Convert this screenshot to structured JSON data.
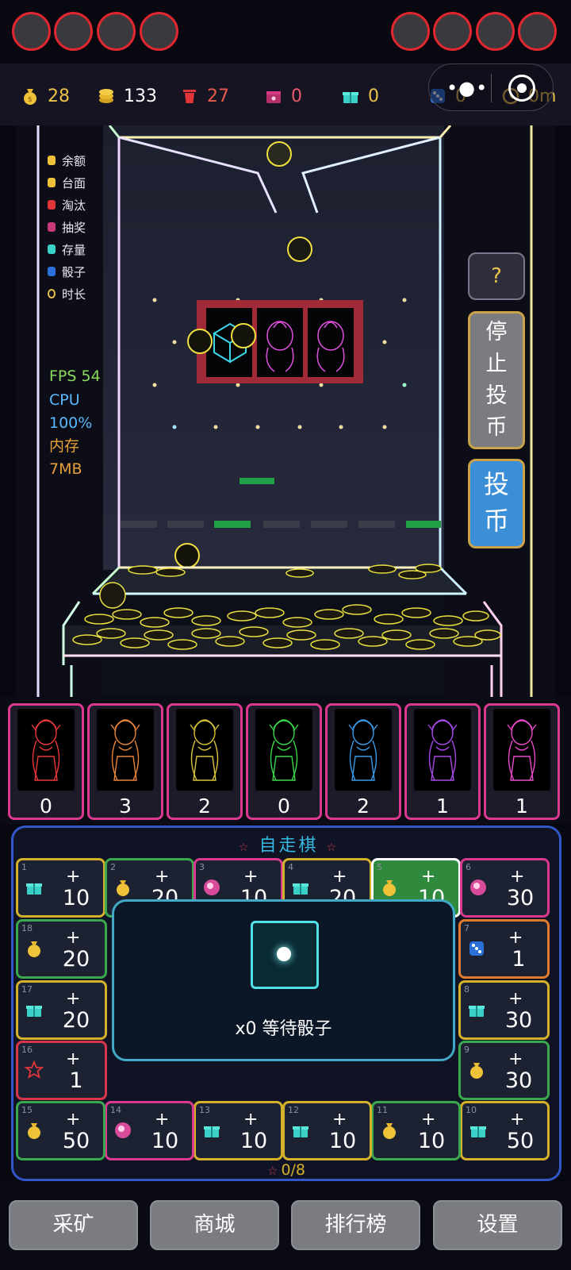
{
  "stats": {
    "balance": "28",
    "table": "133",
    "eliminated": "27",
    "lottery": "0",
    "stock": "0",
    "dice": "0",
    "duration": "0m"
  },
  "legend": [
    "余额",
    "台面",
    "淘汰",
    "抽奖",
    "存量",
    "骰子",
    "时长"
  ],
  "perf": {
    "fps": "FPS 54",
    "cpu_label": "CPU",
    "cpu_value": "100%",
    "mem_label": "内存",
    "mem_value": "7MB"
  },
  "buttons": {
    "help": "?",
    "stop": [
      "停",
      "止",
      "投",
      "币"
    ],
    "insert": [
      "投",
      "币"
    ]
  },
  "cards": [
    {
      "count": "0",
      "color": "#e8383a"
    },
    {
      "count": "3",
      "color": "#e8843a"
    },
    {
      "count": "2",
      "color": "#d8c43a"
    },
    {
      "count": "0",
      "color": "#3ad84a"
    },
    {
      "count": "2",
      "color": "#3a9ae8"
    },
    {
      "count": "1",
      "color": "#a84ae8"
    },
    {
      "count": "1",
      "color": "#e84ac8"
    }
  ],
  "board": {
    "title": "自走棋",
    "dice_text": "x0 等待骰子",
    "progress": "0/8",
    "plus": "+",
    "cells": [
      {
        "n": "1",
        "icon": "gift",
        "amt": "10"
      },
      {
        "n": "2",
        "icon": "bag",
        "amt": "20"
      },
      {
        "n": "3",
        "icon": "lottery",
        "amt": "10"
      },
      {
        "n": "4",
        "icon": "gift",
        "amt": "20"
      },
      {
        "n": "5",
        "icon": "bag",
        "amt": "10"
      },
      {
        "n": "6",
        "icon": "lottery",
        "amt": "30"
      },
      {
        "n": "7",
        "icon": "dice",
        "amt": "1"
      },
      {
        "n": "8",
        "icon": "gift",
        "amt": "30"
      },
      {
        "n": "9",
        "icon": "bag",
        "amt": "30"
      },
      {
        "n": "10",
        "icon": "gift",
        "amt": "50"
      },
      {
        "n": "11",
        "icon": "bag",
        "amt": "10"
      },
      {
        "n": "12",
        "icon": "gift",
        "amt": "10"
      },
      {
        "n": "13",
        "icon": "gift",
        "amt": "10"
      },
      {
        "n": "14",
        "icon": "lottery",
        "amt": "10"
      },
      {
        "n": "15",
        "icon": "bag",
        "amt": "50"
      },
      {
        "n": "16",
        "icon": "star",
        "amt": "1"
      },
      {
        "n": "17",
        "icon": "gift",
        "amt": "20"
      },
      {
        "n": "18",
        "icon": "bag",
        "amt": "20"
      }
    ]
  },
  "nav": [
    "采矿",
    "商城",
    "排行榜",
    "设置"
  ]
}
